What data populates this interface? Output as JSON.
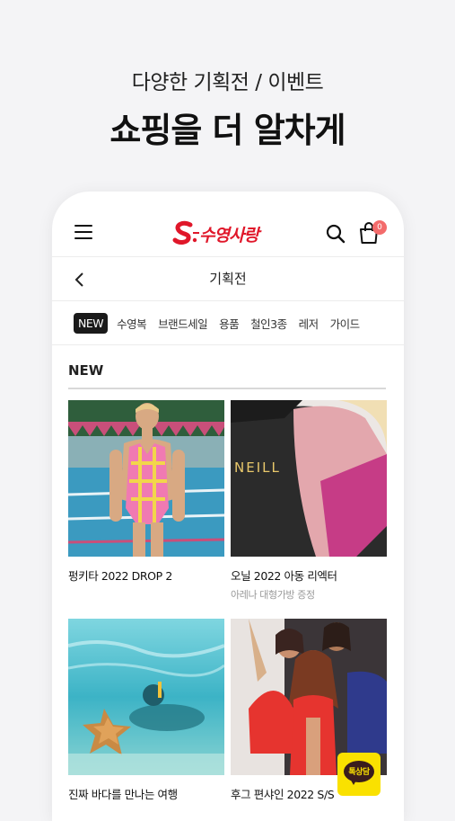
{
  "promo": {
    "subtitle": "다양한 기획전 / 이벤트",
    "title": "쇼핑을 더 알차게"
  },
  "header": {
    "logo_text": "수영사랑",
    "cart_count": "0",
    "brand_color": "#e0172a"
  },
  "page": {
    "title": "기획전"
  },
  "categories": [
    {
      "label": "NEW",
      "active": true
    },
    {
      "label": "수영복",
      "active": false
    },
    {
      "label": "브랜드세일",
      "active": false
    },
    {
      "label": "용품",
      "active": false
    },
    {
      "label": "철인3종",
      "active": false
    },
    {
      "label": "레저",
      "active": false
    },
    {
      "label": "가이드",
      "active": false
    }
  ],
  "section": {
    "title": "NEW"
  },
  "products": [
    {
      "name": "펑키타 2022 DROP 2",
      "desc": ""
    },
    {
      "name": "오닐 2022 아동 리엑터",
      "desc": "아레나 대형가방 증정",
      "print": "NEILL"
    },
    {
      "name": "진짜 바다를 만나는 여행",
      "desc": ""
    },
    {
      "name": "후그 편샤인 2022 S/S",
      "desc": ""
    }
  ],
  "floating": {
    "kakao_label": "톡상담"
  }
}
